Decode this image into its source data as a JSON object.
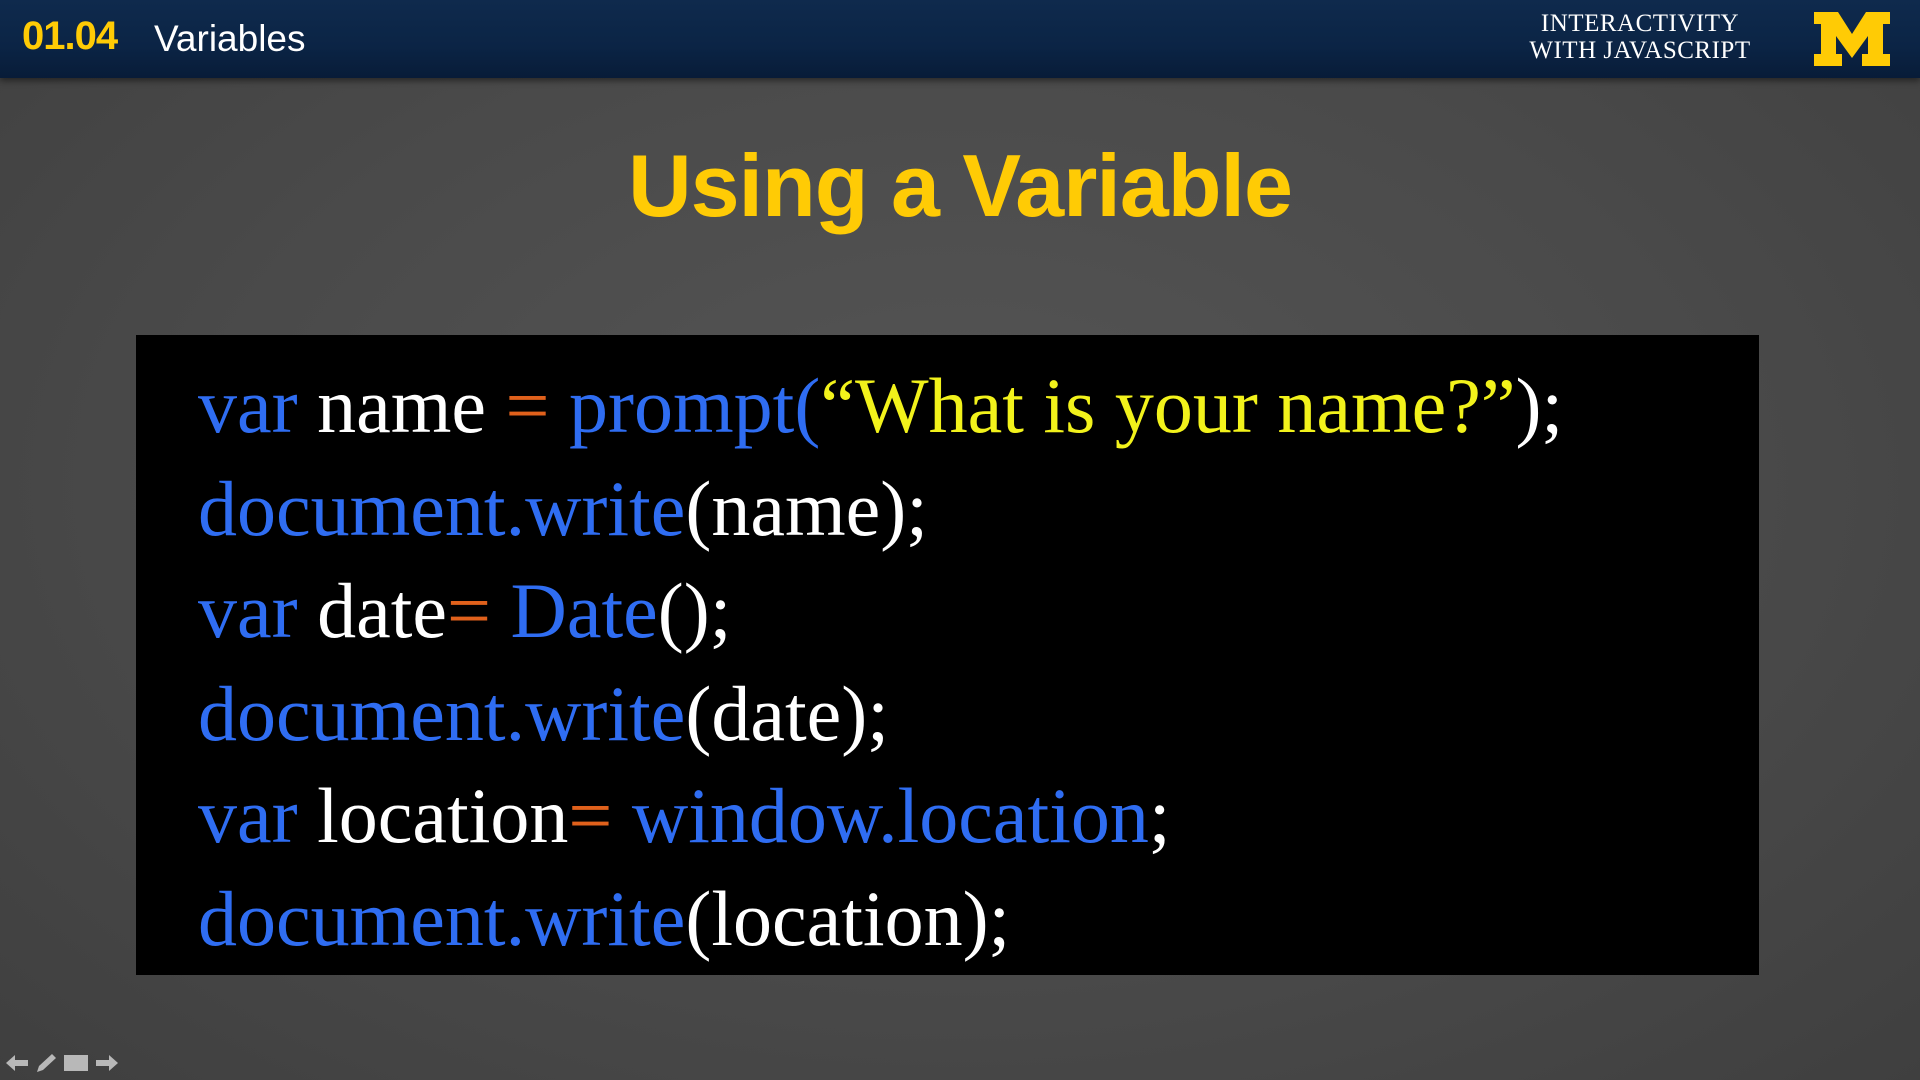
{
  "header": {
    "lesson_number": "01.04",
    "lesson_title": "Variables",
    "course_title_line1": "INTERACTIVITY",
    "course_title_line2": "WITH JAVASCRIPT",
    "logo_letter": "M",
    "background_color": "#0b2445",
    "accent_color": "#ffcb05"
  },
  "slide": {
    "title": "Using a Variable"
  },
  "code": {
    "colors": {
      "keyword": "#2f6df2",
      "identifier": "#ffffff",
      "operator": "#e0611c",
      "string": "#f2f21b"
    },
    "line1": {
      "kw": "var",
      "ident": " name ",
      "op": "=",
      "fn": " prompt(",
      "str": "“What is your name?”",
      "end": ");"
    },
    "line2": {
      "fn": "document.write",
      "rest": "(name);"
    },
    "line3": {
      "kw": "var",
      "ident": " date",
      "op": "=",
      "fn": " Date",
      "rest": "();"
    },
    "line4": {
      "fn": "document.write",
      "rest": "(date);"
    },
    "line5": {
      "kw": "var",
      "ident": " location",
      "op": "=",
      "fn": " window.location",
      "rest": ";"
    },
    "line6": {
      "fn": "document.write",
      "rest": "(location);"
    }
  },
  "nav": {
    "icons": [
      "arrow-left-icon",
      "pen-icon",
      "screen-icon",
      "arrow-right-icon"
    ]
  }
}
